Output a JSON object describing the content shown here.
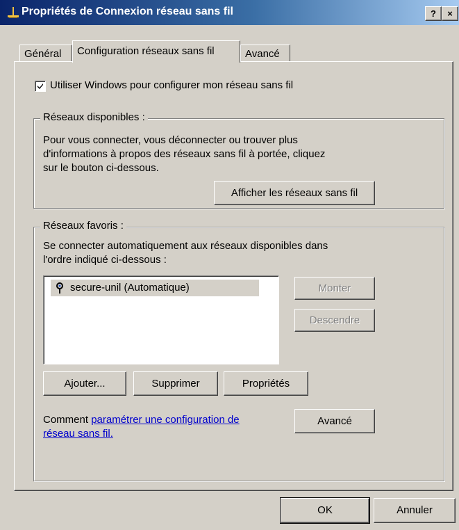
{
  "window": {
    "title": "Propriétés de Connexion réseau sans fil",
    "help_button": "?",
    "close_button": "×"
  },
  "tabs": [
    {
      "label": "Général",
      "active": false
    },
    {
      "label": "Configuration réseaux sans fil",
      "active": true
    },
    {
      "label": "Avancé",
      "active": false
    }
  ],
  "use_windows": {
    "label": "Utiliser Windows pour configurer mon réseau sans fil",
    "checked": true
  },
  "available": {
    "title": "Réseaux disponibles :",
    "desc_lines": [
      "Pour vous connecter, vous déconnecter ou trouver plus",
      "d'informations à propos des réseaux sans fil à portée, cliquez",
      "sur le bouton ci-dessous."
    ],
    "show_button": "Afficher les réseaux sans fil"
  },
  "favorites": {
    "title": "Réseaux favoris :",
    "desc_lines": [
      "Se connecter automatiquement aux réseaux disponibles dans",
      "l'ordre indiqué ci-dessous :"
    ],
    "networks": [
      {
        "name": "secure-unil (Automatique)",
        "icon": "wireless-network-icon"
      }
    ],
    "move_up": "Monter",
    "move_down": "Descendre",
    "add": "Ajouter...",
    "remove": "Supprimer",
    "properties": "Propriétés",
    "help_prefix": "Comment ",
    "help_link_line1": "paramétrer une configuration de",
    "help_link_line2": "réseau sans fil.",
    "advanced": "Avancé"
  },
  "footer": {
    "ok": "OK",
    "cancel": "Annuler"
  }
}
